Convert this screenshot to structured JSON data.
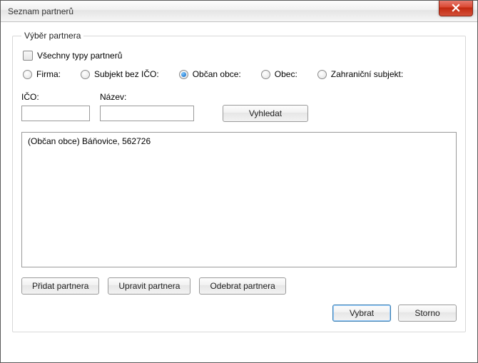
{
  "window": {
    "title": "Seznam partnerů"
  },
  "group": {
    "legend": "Výběr partnera"
  },
  "checkbox": {
    "all_types_label": "Všechny typy partnerů",
    "all_types_checked": false
  },
  "radios": {
    "firma": "Firma:",
    "subjekt_bez_ico": "Subjekt bez IČO:",
    "obcan_obce": "Občan obce:",
    "obec": "Obec:",
    "zahranicni": "Zahraniční subjekt:",
    "selected": "obcan_obce"
  },
  "fields": {
    "ico_label": "IČO:",
    "nazev_label": "Název:",
    "ico_value": "",
    "nazev_value": ""
  },
  "buttons": {
    "search": "Vyhledat",
    "add": "Přidat partnera",
    "edit": "Upravit partnera",
    "remove": "Odebrat partnera",
    "select": "Vybrat",
    "cancel": "Storno"
  },
  "results": {
    "items": [
      "(Občan obce) Báňovice, 562726"
    ]
  }
}
